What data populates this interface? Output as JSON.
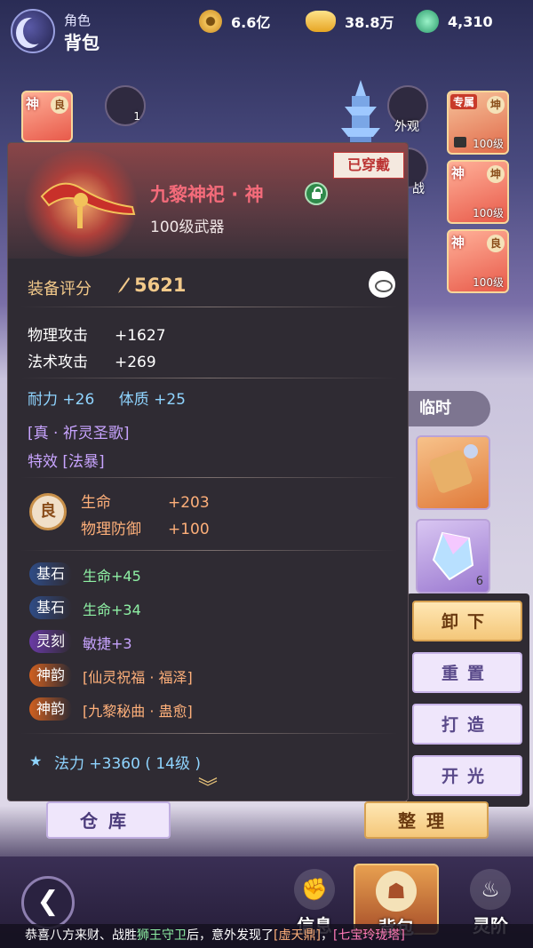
{
  "header": {
    "section_small": "角色",
    "section_big": "背包"
  },
  "currencies": [
    {
      "icon": "coin-icon",
      "value": "6.6亿"
    },
    {
      "icon": "gold-ingot-icon",
      "value": "38.8万"
    },
    {
      "icon": "jade-icon",
      "value": "4,310"
    }
  ],
  "scene": {
    "left_slot": {
      "tier": "神",
      "grade": "良"
    },
    "armor_count": "1",
    "appearance_label": "外观",
    "battle_label": "战",
    "right_slots": [
      {
        "tier": "专属",
        "grade": "坤",
        "level": "100级"
      },
      {
        "tier": "神",
        "grade": "坤",
        "level": "100级"
      },
      {
        "tier": "神",
        "grade": "良",
        "level": "100级"
      }
    ]
  },
  "tooltip": {
    "worn_label": "已穿戴",
    "name": "九黎神祀 · 神",
    "level_type": "100级武器",
    "score_label": "装备评分",
    "score_value": "5621",
    "base_stats": [
      {
        "label": "物理攻击",
        "value": "+1627"
      },
      {
        "label": "法术攻击",
        "value": "+269"
      }
    ],
    "attr_line": {
      "a_label": "耐力",
      "a_value": "+26",
      "b_label": "体质",
      "b_value": "+25"
    },
    "skill": "[真 · 祈灵圣歌]",
    "effect": "特效 [法暴]",
    "refine_grade": "良",
    "refine_stats": [
      {
        "label": "生命",
        "value": "+203"
      },
      {
        "label": "物理防御",
        "value": "+100"
      }
    ],
    "gems": [
      {
        "tag": "基石",
        "text": "生命+45",
        "style": "blue"
      },
      {
        "tag": "基石",
        "text": "生命+34",
        "style": "blue"
      },
      {
        "tag": "灵刻",
        "text": "敏捷+3",
        "style": "purple"
      },
      {
        "tag": "神韵",
        "text": "[仙灵祝福 · 福泽]",
        "style": "orange"
      },
      {
        "tag": "神韵",
        "text": "[九黎秘曲 · 蛊愈]",
        "style": "orange"
      }
    ],
    "mana_line": "法力 +3360 ( 14级 )"
  },
  "side": {
    "temp_tab": "临时",
    "items": [
      {
        "count": ""
      },
      {
        "count": "6"
      }
    ],
    "actions": [
      "卸下",
      "重置",
      "打造",
      "开光"
    ]
  },
  "bottom": {
    "warehouse": "仓库",
    "sort": "整理"
  },
  "nav": [
    {
      "label": "信息",
      "icon": "fist-icon"
    },
    {
      "label": "背包",
      "icon": "bag-icon",
      "active": true
    },
    {
      "label": "灵阶",
      "icon": "flame-icon"
    }
  ],
  "ticker": {
    "p1": "恭喜八方来财、战胜",
    "p2": "狮王守卫",
    "p3": "后，意外发现了",
    "p4": "[虚天鼎]",
    "p5": "，",
    "p6": "[七宝玲珑塔]"
  }
}
